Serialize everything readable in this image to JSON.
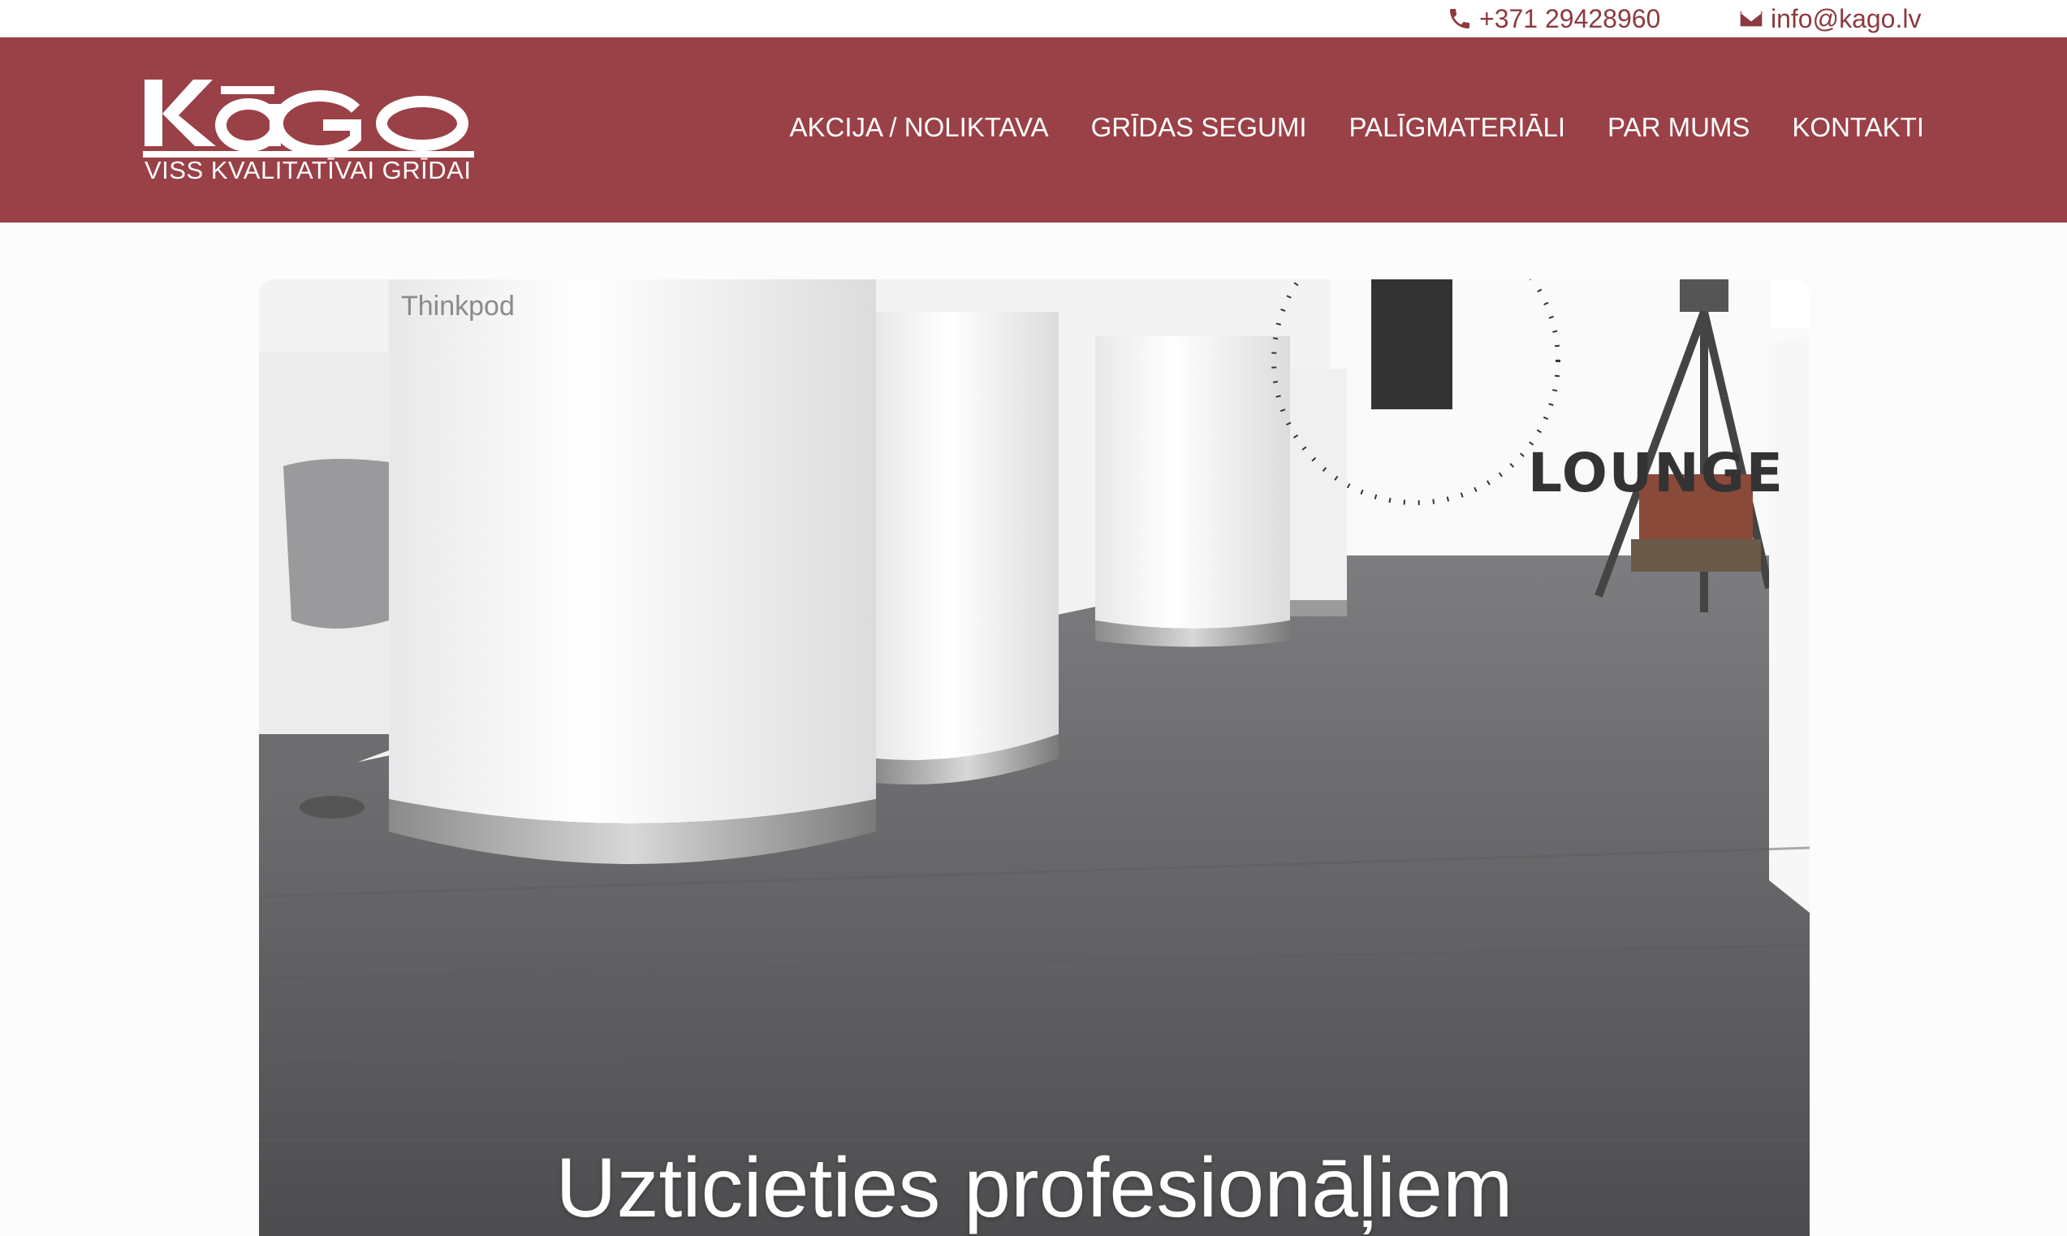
{
  "topbar": {
    "phone": "+371 29428960",
    "email": "info@kago.lv",
    "phone_icon": "phone-icon",
    "email_icon": "envelope-icon"
  },
  "header": {
    "logo_text": "KāGO",
    "logo_tagline": "VISS KVALITATĪVAI GRĪDAI",
    "nav": [
      {
        "label": "AKCIJA / NOLIKTAVA"
      },
      {
        "label": "GRĪDAS SEGUMI"
      },
      {
        "label": "PALĪGMATERIĀLI"
      },
      {
        "label": "PAR MUMS"
      },
      {
        "label": "KONTAKTI"
      }
    ]
  },
  "hero": {
    "title": "Uzticieties profesionāļiem",
    "image_brand": "Thinkpod",
    "image_sign": "LOUNGE"
  },
  "colors": {
    "brand": "#9a4047",
    "accent_text": "#8c3a40",
    "white": "#ffffff"
  }
}
